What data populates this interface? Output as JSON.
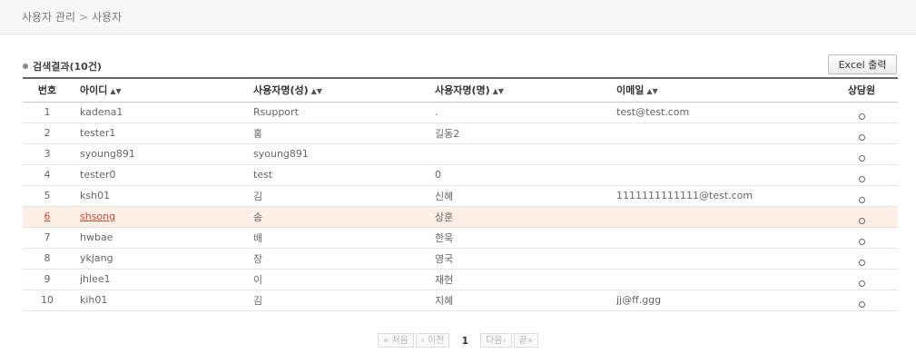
{
  "breadcrumb": {
    "parent": "사용자 관리",
    "separator": ">",
    "current": "사용자"
  },
  "result": {
    "title": "검색결과(10건)"
  },
  "toolbar": {
    "excel_label": "Excel 출력"
  },
  "table": {
    "headers": {
      "no": "번호",
      "id": "아이디",
      "lastname": "사용자명(성)",
      "firstname": "사용자명(명)",
      "email": "이메일",
      "counselor": "상담원"
    },
    "sort_icon": "sort-icon",
    "rows": [
      {
        "no": "1",
        "id": "kadena1",
        "lastname": "Rsupport",
        "firstname": ".",
        "email": "test@test.com",
        "counselor": "O"
      },
      {
        "no": "2",
        "id": "tester1",
        "lastname": "홍",
        "firstname": "길동2",
        "email": "",
        "counselor": "O"
      },
      {
        "no": "3",
        "id": "syoung891",
        "lastname": "syoung891",
        "firstname": "",
        "email": "",
        "counselor": "O"
      },
      {
        "no": "4",
        "id": "tester0",
        "lastname": "test",
        "firstname": "0",
        "email": "",
        "counselor": "O"
      },
      {
        "no": "5",
        "id": "ksh01",
        "lastname": "김",
        "firstname": "신혜",
        "email": "1111111111111@test.com",
        "counselor": "O"
      },
      {
        "no": "6",
        "id": "shsong",
        "lastname": "송",
        "firstname": "상훈",
        "email": "",
        "counselor": "O",
        "selected": true
      },
      {
        "no": "7",
        "id": "hwbae",
        "lastname": "배",
        "firstname": "한욱",
        "email": "",
        "counselor": "O"
      },
      {
        "no": "8",
        "id": "ykjang",
        "lastname": "장",
        "firstname": "영국",
        "email": "",
        "counselor": "O"
      },
      {
        "no": "9",
        "id": "jhlee1",
        "lastname": "이",
        "firstname": "재현",
        "email": "",
        "counselor": "O"
      },
      {
        "no": "10",
        "id": "kih01",
        "lastname": "김",
        "firstname": "지혜",
        "email": "jj@ff.ggg",
        "counselor": "O"
      }
    ]
  },
  "pagination": {
    "first": "« 처음",
    "prev": "‹ 이전",
    "current": "1",
    "next": "다음›",
    "last": "끝»"
  }
}
